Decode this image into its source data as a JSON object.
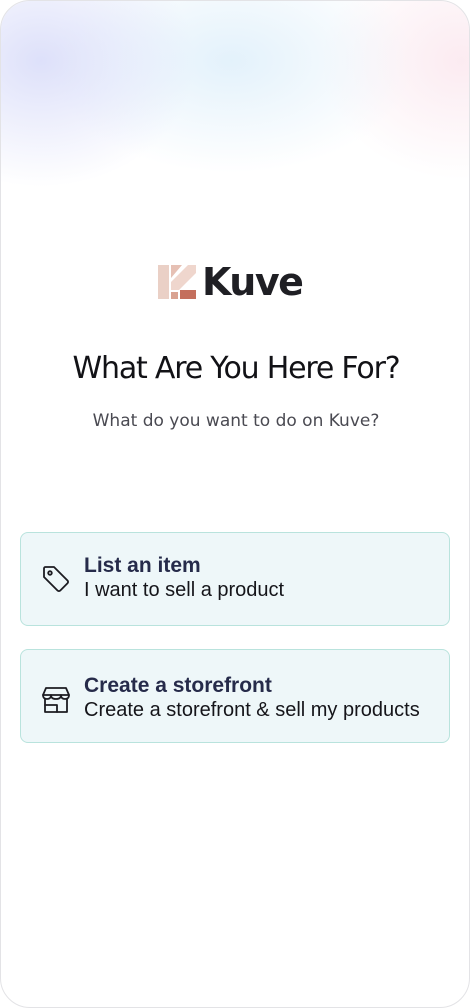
{
  "brand": {
    "name": "Kuve",
    "logo_icon": "kuve-logo-mark",
    "colors": {
      "logo_light": "#e9c2b6",
      "logo_dark": "#c26b59"
    }
  },
  "heading": "What Are You Here For?",
  "subheading": "What do you want to do on Kuve?",
  "options": [
    {
      "icon": "tag-icon",
      "title": "List an item",
      "description": "I want to sell a product"
    },
    {
      "icon": "storefront-icon",
      "title": "Create a storefront",
      "description": "Create a storefront & sell my products"
    }
  ],
  "colors": {
    "card_background": "#eef7f9",
    "card_border": "#b9e3dd",
    "title_text": "#262b4a"
  }
}
